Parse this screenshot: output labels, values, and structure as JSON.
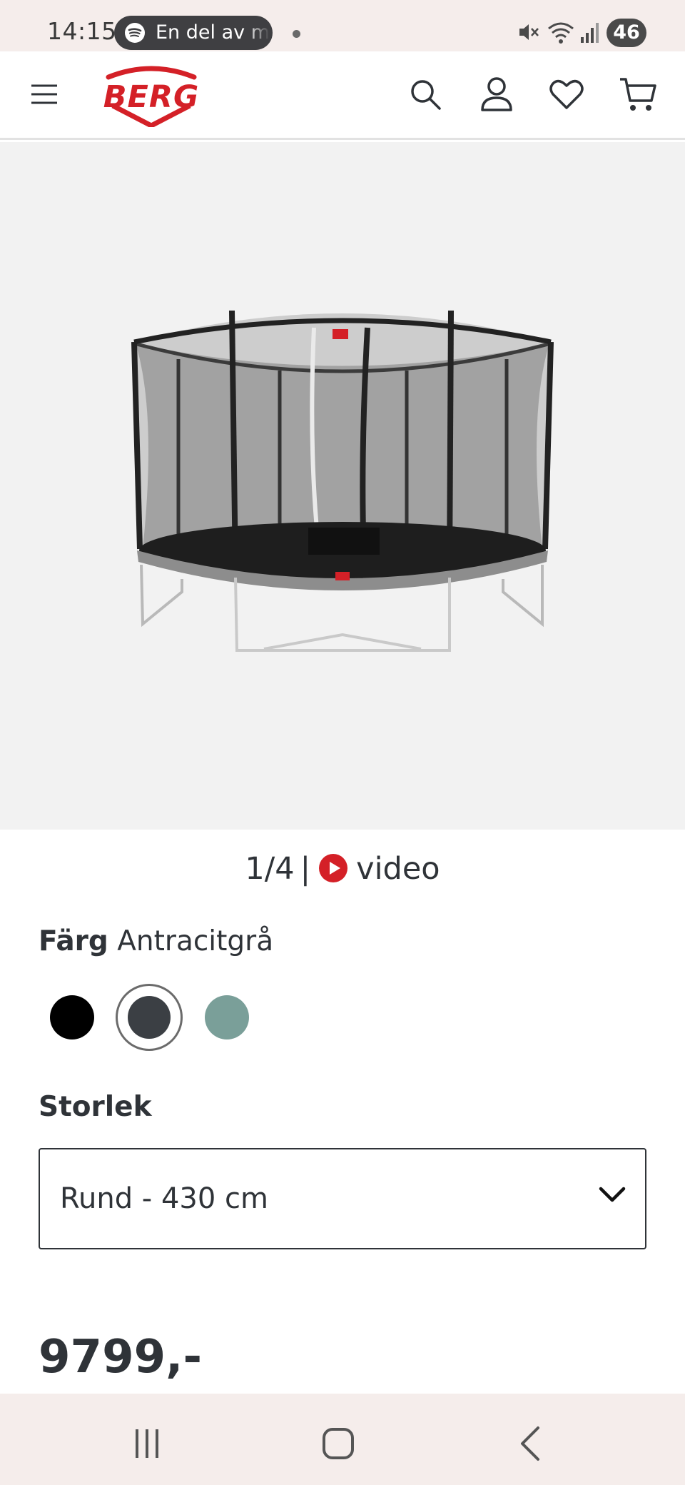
{
  "status_bar": {
    "time": "14:15",
    "media_text": "En del av m",
    "battery": "46",
    "icons": [
      "spotify-icon",
      "mute-icon",
      "wifi-icon",
      "signal-icon"
    ]
  },
  "header": {
    "logo_text": "BERG",
    "icons": [
      "menu-icon",
      "search-icon",
      "account-icon",
      "heart-icon",
      "cart-icon"
    ]
  },
  "gallery": {
    "position": "1/4",
    "separator": "|",
    "video_label": "video"
  },
  "color": {
    "label": "Färg",
    "selected": "Antracitgrå",
    "swatches": [
      {
        "name": "black",
        "hex": "#000000"
      },
      {
        "name": "anthracite",
        "hex": "#3b3f44",
        "selected": true
      },
      {
        "name": "green",
        "hex": "#7a9f99"
      }
    ]
  },
  "size": {
    "label": "Storlek",
    "selected": "Rund - 430 cm"
  },
  "price": "9799,-",
  "colors": {
    "brand_red": "#d42027",
    "text": "#2f3338",
    "status_bg": "#f5edeb",
    "gallery_bg": "#f2f2f2"
  }
}
